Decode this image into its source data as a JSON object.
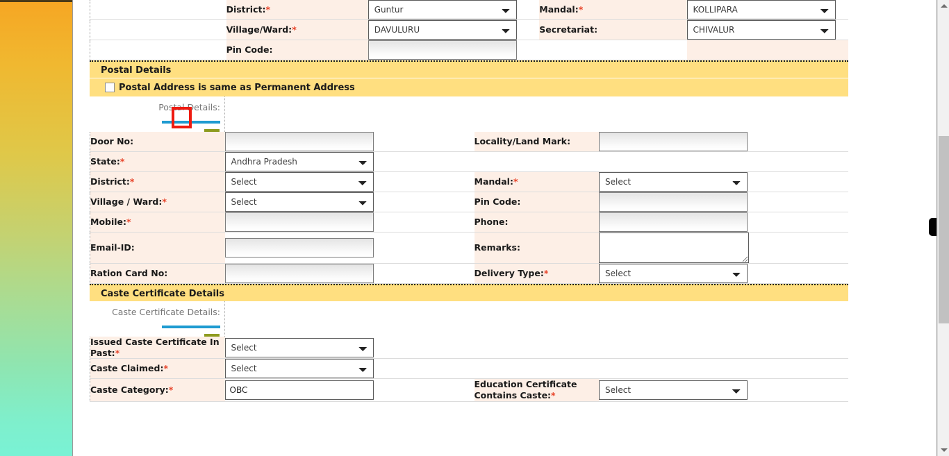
{
  "theme": {
    "section_header_bg": "#FFDF80",
    "label_bg": "#FDEFE6",
    "accent_blue": "#1F9BD1",
    "accent_olive": "#8E9B1F",
    "required_star": "#E8452B",
    "annotation_color": "#EE1B11"
  },
  "permanent_address": {
    "rows": [
      {
        "left_label": "District:",
        "left_required": true,
        "left_control": {
          "type": "select",
          "value": "Guntur"
        },
        "right_label": "Mandal:",
        "right_required": true,
        "right_control": {
          "type": "select",
          "value": "KOLLIPARA"
        }
      },
      {
        "left_label": "Village/Ward:",
        "left_required": true,
        "left_control": {
          "type": "select",
          "value": "DAVULURU"
        },
        "right_label": "Secretariat:",
        "right_required": false,
        "right_control": {
          "type": "select",
          "value": "CHIVALUR"
        }
      },
      {
        "left_label": "Pin Code:",
        "left_required": false,
        "left_control": {
          "type": "text",
          "value": ""
        },
        "right_label": "",
        "right_required": false,
        "right_control": null
      }
    ]
  },
  "postal_section": {
    "header": "Postal Details",
    "same_as_permanent": {
      "label": "Postal Address is same as Permanent Address",
      "checked": false
    },
    "step_label": "Postal Details:",
    "rows": [
      {
        "left_label": "Door No:",
        "left_required": false,
        "left_control": {
          "type": "text",
          "value": ""
        },
        "right_label": "Locality/Land Mark:",
        "right_required": false,
        "right_control": {
          "type": "text",
          "value": ""
        }
      },
      {
        "left_label": "State:",
        "left_required": true,
        "left_control": {
          "type": "select",
          "value": "Andhra Pradesh"
        },
        "right_label": "",
        "right_required": false,
        "right_control": null
      },
      {
        "left_label": "District:",
        "left_required": true,
        "left_control": {
          "type": "select",
          "value": "Select"
        },
        "right_label": "Mandal:",
        "right_required": true,
        "right_control": {
          "type": "select",
          "value": "Select"
        }
      },
      {
        "left_label": "Village / Ward:",
        "left_required": true,
        "left_control": {
          "type": "select",
          "value": "Select"
        },
        "right_label": "Pin Code:",
        "right_required": false,
        "right_control": {
          "type": "text",
          "value": ""
        }
      },
      {
        "left_label": "Mobile:",
        "left_required": true,
        "left_control": {
          "type": "text",
          "value": ""
        },
        "right_label": "Phone:",
        "right_required": false,
        "right_control": {
          "type": "text",
          "value": ""
        }
      },
      {
        "left_label": "Email-ID:",
        "left_required": false,
        "left_control": {
          "type": "text",
          "value": ""
        },
        "right_label": "Remarks:",
        "right_required": false,
        "right_control": {
          "type": "textarea",
          "value": ""
        }
      },
      {
        "left_label": "Ration Card No:",
        "left_required": false,
        "left_control": {
          "type": "text",
          "value": ""
        },
        "right_label": "Delivery Type:",
        "right_required": true,
        "right_control": {
          "type": "select",
          "value": "Select"
        }
      }
    ]
  },
  "caste_section": {
    "header": "Caste Certificate Details",
    "step_label": "Caste Certificate Details:",
    "rows": [
      {
        "left_label": "Issued Caste Certificate In Past:",
        "left_required": true,
        "left_control": {
          "type": "select",
          "value": "Select"
        },
        "right_label": "",
        "right_required": false,
        "right_control": null
      },
      {
        "left_label": "Caste Claimed:",
        "left_required": true,
        "left_control": {
          "type": "select",
          "value": "Select"
        },
        "right_label": "",
        "right_required": false,
        "right_control": null
      },
      {
        "left_label": "Caste Category:",
        "left_required": true,
        "left_control": {
          "type": "text",
          "value": "OBC"
        },
        "right_label": "Education Certificate Contains Caste:",
        "right_required": true,
        "right_control": {
          "type": "select",
          "value": "Select"
        }
      }
    ]
  },
  "scrollbar": {
    "up_arrow": "scroll-up",
    "down_arrow": "scroll-down"
  }
}
